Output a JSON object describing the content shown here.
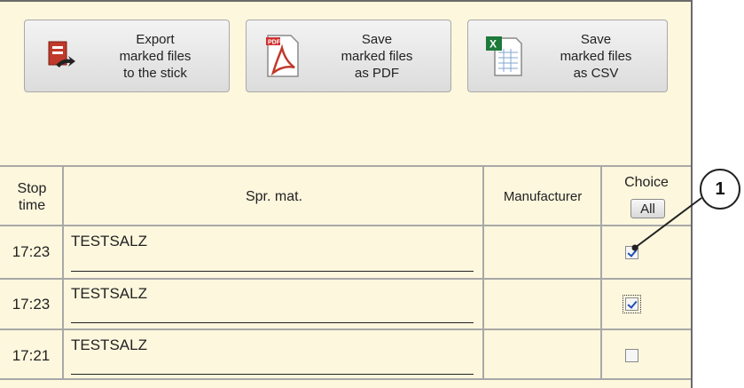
{
  "toolbar": {
    "export_label": "Export\nmarked files\nto the stick",
    "pdf_label": "Save\nmarked files\nas PDF",
    "csv_label": "Save\nmarked files\nas CSV",
    "export_icon": "usb-export-icon",
    "pdf_icon": "pdf-file-icon",
    "csv_icon": "spreadsheet-icon"
  },
  "table": {
    "headers": {
      "stop_time": "Stop\ntime",
      "spr_mat": "Spr. mat.",
      "manufacturer": "Manufacturer",
      "choice": "Choice",
      "all": "All"
    },
    "rows": [
      {
        "time": "17:23",
        "material": "TESTSALZ",
        "manufacturer": "",
        "checked": true,
        "focused": false
      },
      {
        "time": "17:23",
        "material": "TESTSALZ",
        "manufacturer": "",
        "checked": true,
        "focused": true
      },
      {
        "time": "17:21",
        "material": "TESTSALZ",
        "manufacturer": "",
        "checked": false,
        "focused": false
      }
    ]
  },
  "callout": {
    "label": "1"
  },
  "colors": {
    "panel_bg": "#fdf7dd",
    "grid": "#a8a8a8",
    "check": "#1f4fb5"
  }
}
